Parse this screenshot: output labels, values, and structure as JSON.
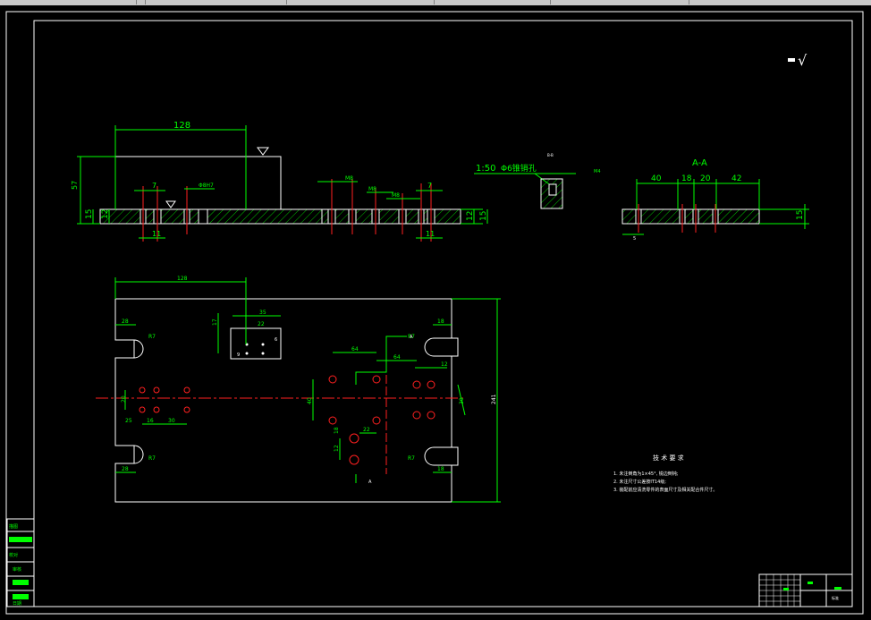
{
  "colors": {
    "background": "#000000",
    "dimension": "#00ff00",
    "outline": "#ffffff",
    "centerline": "#ff2020",
    "hatch": "#00c000"
  },
  "front_view": {
    "dim_length": "128",
    "dim_height": "57",
    "dim_thickness_left": "15",
    "dim_sub_left": "12",
    "dim_thickness_right": "15",
    "dim_sub_right": "12",
    "dim_hole_a": "7",
    "dim_hole_b": "11",
    "dim_hole_c": "7",
    "dim_hole_d": "11",
    "dim_fit": "Φ8H7",
    "thread_1": "M8",
    "thread_2": "M8",
    "thread_3": "M8"
  },
  "pin_hole_note": {
    "scale": "1:50",
    "label": "Φ6锥销孔",
    "thread": "M4",
    "small": "B-B"
  },
  "section_aa": {
    "title": "A-A",
    "dims": [
      "40",
      "18",
      "20",
      "42"
    ],
    "thickness": "15",
    "offset": "5"
  },
  "plan_view": {
    "dim_top": "128",
    "dim_total_height": "241",
    "dim_right": "30",
    "dim_left_top": "28",
    "dim_left_bottom": "28",
    "dim_right_top": "18",
    "dim_right_bottom": "18",
    "radius_1": "R7",
    "radius_2": "R7",
    "radius_3": "R7",
    "radius_4": "R7",
    "dim_25": "25",
    "dim_16": "16",
    "dim_30": "30",
    "dim_20": "20",
    "dim_35": "35",
    "dim_22": "22",
    "dim_17": "17",
    "dim_64a": "64",
    "dim_64b": "64",
    "dim_22b": "22",
    "dim_12": "12",
    "dim_40": "40",
    "dim_18": "18",
    "dim_22c": "22",
    "dim_12b": "12",
    "section_mark": "A",
    "section_mark_2": "A",
    "dim_6": "6",
    "dim_9": "9"
  },
  "tech_requirements": {
    "title": "技 术 要 求",
    "items": [
      "1. 未注倒角为1×45°, 锐边倒钝;",
      "2. 未注尺寸公差按IT14级;",
      "3. 装配前应清洗零件的表面尺寸及相关配合件尺寸。"
    ]
  },
  "roughness_symbol": "√",
  "title_block": {
    "label": "标准"
  },
  "side_strip": {
    "labels": [
      "描图",
      "校对",
      "审核",
      "日期"
    ]
  }
}
